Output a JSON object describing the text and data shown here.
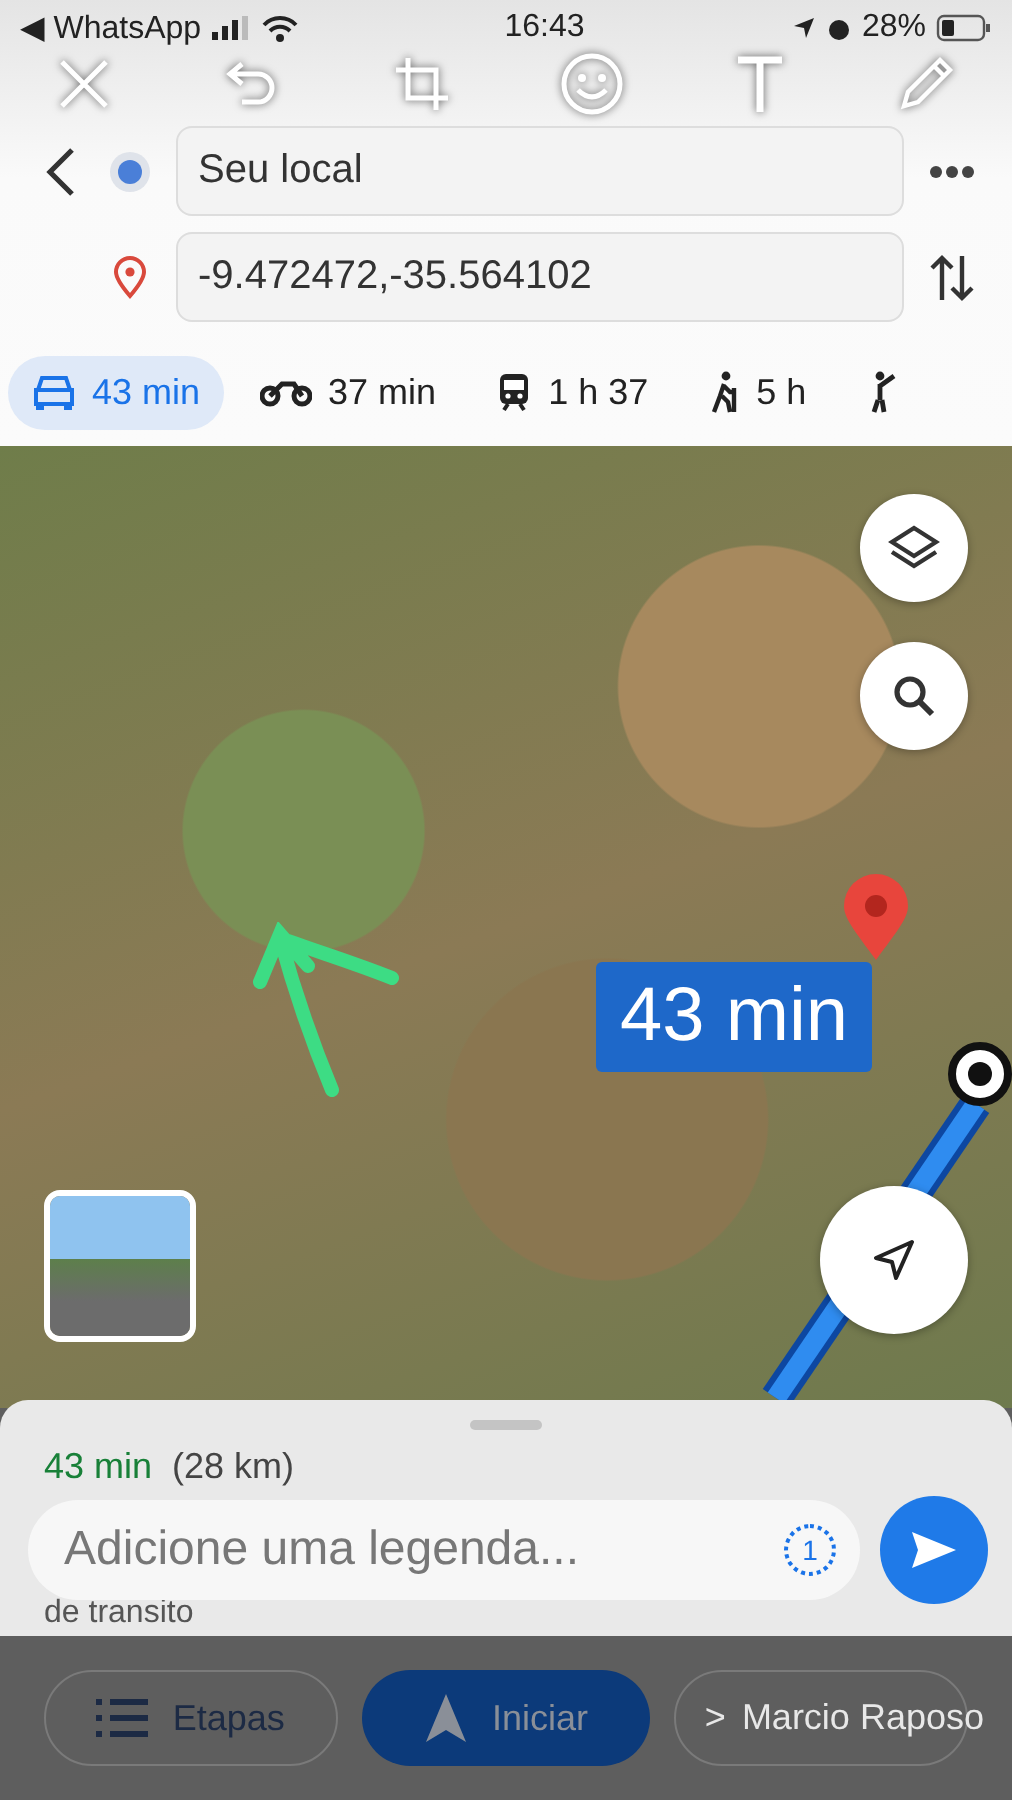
{
  "status_bar": {
    "back_app": "◀ WhatsApp",
    "time": "16:43",
    "battery": "28%"
  },
  "route": {
    "origin": "Seu local",
    "destination": "-9.472472,-35.564102"
  },
  "modes": [
    {
      "kind": "car",
      "label": "43 min",
      "selected": true
    },
    {
      "kind": "motorcycle",
      "label": "37 min",
      "selected": false
    },
    {
      "kind": "transit",
      "label": "1 h 37",
      "selected": false
    },
    {
      "kind": "walk",
      "label": "5 h",
      "selected": false
    },
    {
      "kind": "ride",
      "selected": false
    }
  ],
  "map": {
    "route_label": "43 min"
  },
  "sheet": {
    "duration": "43 min",
    "distance": "(28 km)",
    "note": "de transito"
  },
  "caption": {
    "placeholder": "Adicione uma legenda...",
    "view_once": "1"
  },
  "actions": [
    {
      "kind": "steps",
      "label": "Etapas"
    },
    {
      "kind": "start",
      "label": "Iniciar"
    },
    {
      "kind": "pin"
    }
  ],
  "recipient": {
    "chevron": ">",
    "name": "Marcio Raposo"
  }
}
